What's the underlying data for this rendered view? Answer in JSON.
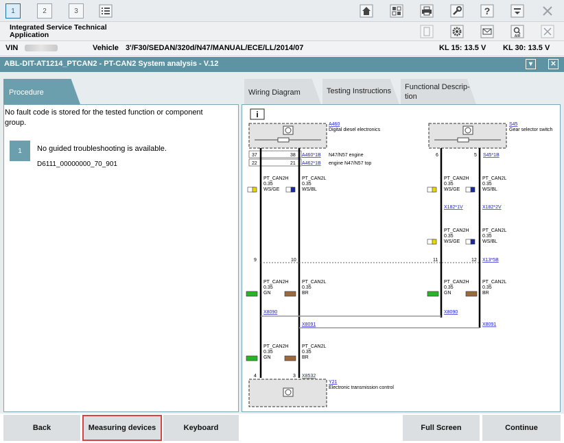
{
  "toolbar": {
    "tabs": [
      "1",
      "2",
      "3"
    ]
  },
  "app": {
    "title": "Integrated Service Technical Application"
  },
  "vehicle_bar": {
    "vin_label": "VIN",
    "vehicle_label": "Vehicle",
    "vehicle_value": "3'/F30/SEDAN/320d/N47/MANUAL/ECE/LL/2014/07",
    "kl15": "KL 15:  13.5 V",
    "kl30": "KL 30:  13.5 V"
  },
  "panel_title": "ABL-DIT-AT1214_PTCAN2 - PT-CAN2 System analysis - V.12",
  "tabs": {
    "procedure": "Procedure",
    "wiring": "Wiring Diagram",
    "testing": "Testing Instructions",
    "functional": "Functional Descrip- tion"
  },
  "procedure": {
    "message": "No fault code is stored for the tested function or component group.",
    "step_number": "1",
    "step_text": "No guided troubleshooting is available.",
    "doc_id": "D6111_00000000_70_901"
  },
  "diagram": {
    "info": "i",
    "a460_id": "A460",
    "a460_desc": "Digital diesel electronics",
    "s45_id": "S45",
    "s45_desc": "Gear selector switch",
    "pin37": "37",
    "pin38": "38",
    "pin22": "22",
    "pin21": "21",
    "pin6": "6",
    "pin5": "5",
    "pin9": "9",
    "pin10": "10",
    "pin11": "11",
    "pin12": "12",
    "pin4": "4",
    "pin3": "3",
    "a460_1b": "A460*1B",
    "a462_1b": "A462*1B",
    "s45_1b": "S45*1B",
    "n47_engine": "N47/N57 engine",
    "n47_top": "engine N47/N57 top",
    "x182_1v": "X182*1V",
    "x182_2v": "X182*2V",
    "x13_5b": "X13*5B",
    "x8090": "X8090",
    "x8091": "X8091",
    "x8532": "X8532",
    "y21_id": "Y21",
    "y21_desc": "Electronic transmission control",
    "can_h": "PT_CAN2H",
    "can_l": "PT_CAN2L",
    "gauge": "0.35",
    "ws_ge": "WS/GE",
    "ws_bl": "WS/BL",
    "gn": "GN",
    "br": "BR"
  },
  "buttons": {
    "back": "Back",
    "measuring": "Measuring devices",
    "keyboard": "Keyboard",
    "fullscreen": "Full Screen",
    "continue": "Continue"
  },
  "colors": {
    "accent": "#5e93a4",
    "highlight": "#d94040"
  }
}
